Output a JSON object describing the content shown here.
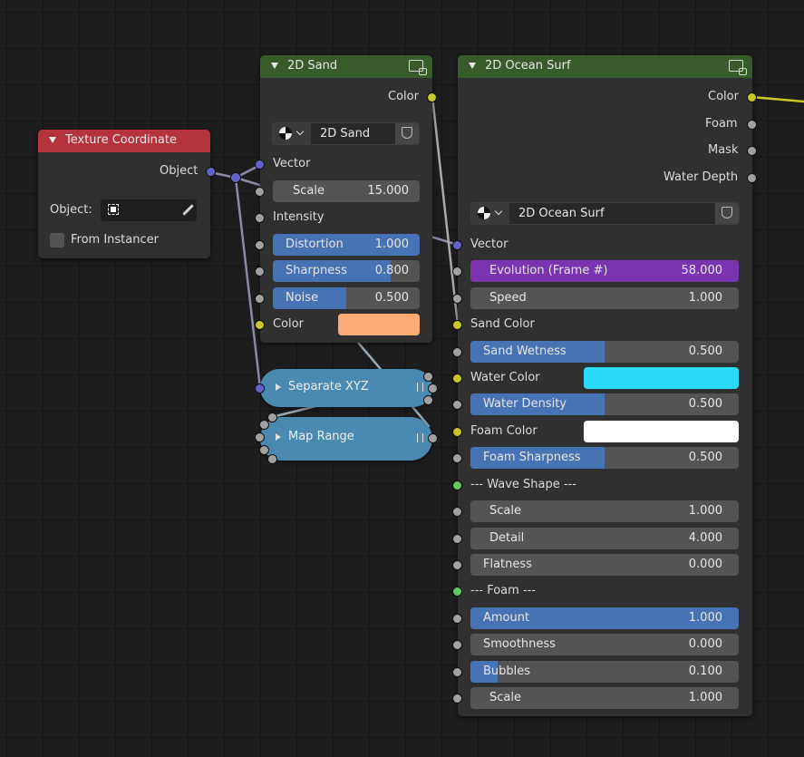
{
  "colors": {
    "header_input": "#b3343b",
    "header_group": "#375c29",
    "field_fill": "#4772b3",
    "evolution_fill": "#7a34b0",
    "sand_swatch": "#ffab78",
    "water_swatch": "#2bdaf7",
    "foam_swatch": "#ffffff",
    "reroute": "#4a8ab0"
  },
  "texture_coordinate": {
    "title": "Texture Coordinate",
    "output_object": "Object",
    "object_label": "Object:",
    "from_instancer": "From Instancer",
    "icons": [
      "object-icon",
      "eyedropper-icon"
    ]
  },
  "sand": {
    "title": "2D Sand",
    "output_color": "Color",
    "group_name": "2D Sand",
    "vector": "Vector",
    "scale": {
      "label": "Scale",
      "value": "15.000"
    },
    "intensity": "Intensity",
    "distortion": {
      "label": "Distortion",
      "value": "1.000",
      "fraction": 1.0
    },
    "sharpness": {
      "label": "Sharpness",
      "value": "0.800",
      "fraction": 0.8
    },
    "noise": {
      "label": "Noise",
      "value": "0.500",
      "fraction": 0.5
    },
    "color": "Color"
  },
  "separate_xyz": {
    "title": "Separate XYZ"
  },
  "map_range": {
    "title": "Map Range"
  },
  "ocean": {
    "title": "2D Ocean Surf",
    "outputs": [
      "Color",
      "Foam",
      "Mask",
      "Water Depth"
    ],
    "group_name": "2D Ocean Surf",
    "vector": "Vector",
    "evolution": {
      "label": "Evolution (Frame #)",
      "value": "58.000",
      "fraction": 1.0
    },
    "speed": {
      "label": "Speed",
      "value": "1.000"
    },
    "sand_color": "Sand Color",
    "sand_wetness": {
      "label": "Sand Wetness",
      "value": "0.500",
      "fraction": 0.5
    },
    "water_color": "Water Color",
    "water_density": {
      "label": "Water Density",
      "value": "0.500",
      "fraction": 0.5
    },
    "foam_color": "Foam Color",
    "foam_sharpness": {
      "label": "Foam Sharpness",
      "value": "0.500",
      "fraction": 0.5
    },
    "wave_shape": "--- Wave Shape ---",
    "wave_scale": {
      "label": "Scale",
      "value": "1.000"
    },
    "detail": {
      "label": "Detail",
      "value": "4.000"
    },
    "flatness": {
      "label": "Flatness",
      "value": "0.000"
    },
    "foam_section": "--- Foam ---",
    "amount": {
      "label": "Amount",
      "value": "1.000",
      "fraction": 1.0
    },
    "smoothness": {
      "label": "Smoothness",
      "value": "0.000",
      "fraction": 0.0
    },
    "bubbles": {
      "label": "Bubbles",
      "value": "0.100",
      "fraction": 0.1
    },
    "foam_scale": {
      "label": "Scale",
      "value": "1.000"
    }
  }
}
